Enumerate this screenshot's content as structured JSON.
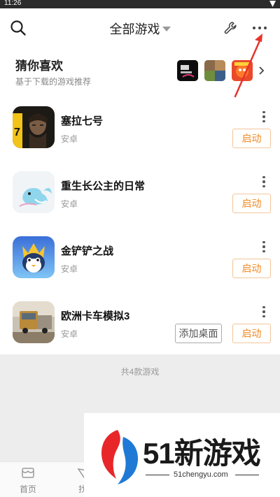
{
  "status": {
    "time": "11:26"
  },
  "header": {
    "title": "全部游戏"
  },
  "recommend": {
    "title": "猜你喜欢",
    "subtitle": "基于下载的游戏推荐"
  },
  "games": [
    {
      "name": "塞拉七号",
      "platform": "安卓",
      "launch": "启动"
    },
    {
      "name": "重生长公主的日常",
      "platform": "安卓",
      "launch": "启动"
    },
    {
      "name": "金铲铲之战",
      "platform": "安卓",
      "launch": "启动"
    },
    {
      "name": "欧洲卡车模拟3",
      "platform": "安卓",
      "launch": "启动",
      "desktop": "添加桌面"
    }
  ],
  "summary": {
    "count_text": "共4款游戏"
  },
  "nav": {
    "home": "首页",
    "find": "找"
  },
  "watermark": {
    "text": "51新游戏",
    "url": "51chengyu.com"
  },
  "colors": {
    "accent": "#f08a24",
    "annotation": "#e8322b"
  }
}
